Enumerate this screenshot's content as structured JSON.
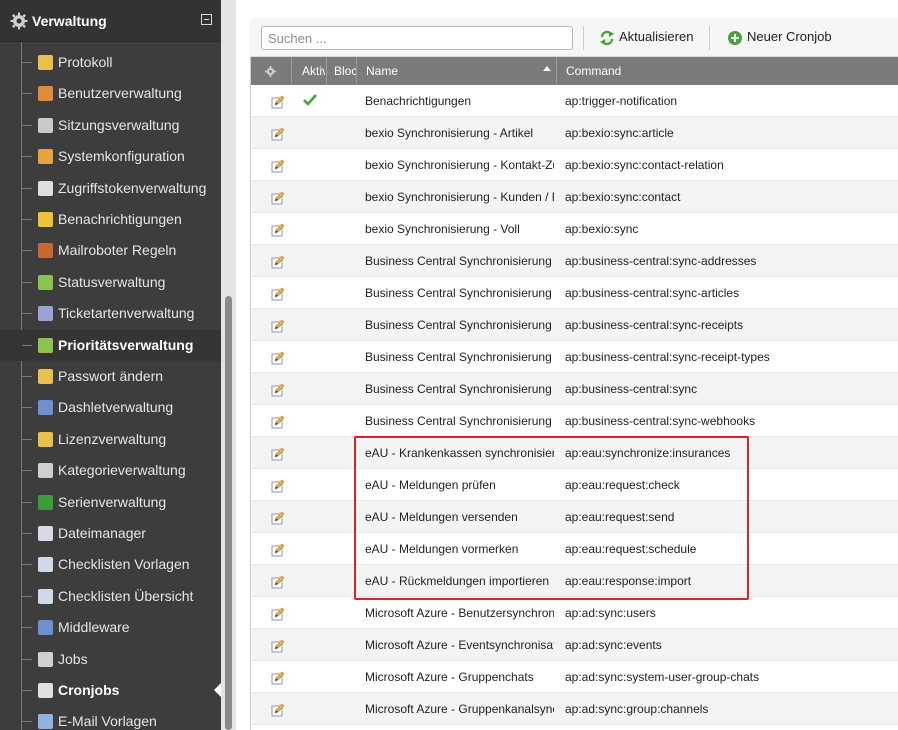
{
  "sidebar": {
    "title": "Verwaltung",
    "items": [
      {
        "label": "Protokoll",
        "icon": "pencil-icon",
        "color": "#e8c04a"
      },
      {
        "label": "Benutzerverwaltung",
        "icon": "user-icon",
        "color": "#e08a3c"
      },
      {
        "label": "Sitzungsverwaltung",
        "icon": "session-icon",
        "color": "#c9c9c9"
      },
      {
        "label": "Systemkonfiguration",
        "icon": "wrench-icon",
        "color": "#e8a33a"
      },
      {
        "label": "Zugriffstokenverwaltung",
        "icon": "infinity-icon",
        "color": "#dddddd"
      },
      {
        "label": "Benachrichtigungen",
        "icon": "note-icon",
        "color": "#f0c13b"
      },
      {
        "label": "Mailroboter Regeln",
        "icon": "hammer-icon",
        "color": "#c9682a"
      },
      {
        "label": "Statusverwaltung",
        "icon": "status-icon",
        "color": "#8cc34a"
      },
      {
        "label": "Ticketartenverwaltung",
        "icon": "tag-icon",
        "color": "#9aa3d6"
      },
      {
        "label": "Prioritätsverwaltung",
        "icon": "priority-icon",
        "color": "#8cc34a"
      },
      {
        "label": "Passwort ändern",
        "icon": "lock-icon",
        "color": "#e8c04a"
      },
      {
        "label": "Dashletverwaltung",
        "icon": "dashlet-icon",
        "color": "#6f8fd0"
      },
      {
        "label": "Lizenzverwaltung",
        "icon": "license-icon",
        "color": "#e8c04a"
      },
      {
        "label": "Kategorieverwaltung",
        "icon": "category-icon",
        "color": "#cfcfcf"
      },
      {
        "label": "Serienverwaltung",
        "icon": "series-icon",
        "color": "#3f9a3a"
      },
      {
        "label": "Dateimanager",
        "icon": "files-icon",
        "color": "#d8d8e8"
      },
      {
        "label": "Checklisten Vorlagen",
        "icon": "checklist-icon",
        "color": "#cfd8e8"
      },
      {
        "label": "Checklisten Übersicht",
        "icon": "checklist-overview-icon",
        "color": "#cfd8e8"
      },
      {
        "label": "Middleware",
        "icon": "middleware-icon",
        "color": "#6f8fd0"
      },
      {
        "label": "Jobs",
        "icon": "jobs-icon",
        "color": "#d0d0d0"
      },
      {
        "label": "Cronjobs",
        "icon": "cronjob-icon",
        "color": "#e0e0e0"
      },
      {
        "label": "E-Mail Vorlagen",
        "icon": "email-icon",
        "color": "#8fb3e0"
      }
    ]
  },
  "toolbar": {
    "search_placeholder": "Suchen ...",
    "refresh_label": "Aktualisieren",
    "new_label": "Neuer Cronjob"
  },
  "grid": {
    "headers": {
      "settings": "",
      "active": "Aktiv",
      "blocked": "Blockiert",
      "name": "Name",
      "command": "Command"
    },
    "rows": [
      {
        "name": "Benachrichtigungen",
        "command": "ap:trigger-notification",
        "active": true
      },
      {
        "name": "bexio Synchronisierung - Artikel",
        "command": "ap:bexio:sync:article",
        "active": false
      },
      {
        "name": "bexio Synchronisierung - Kontakt-Zuordnung",
        "command": "ap:bexio:sync:contact-relation",
        "active": false
      },
      {
        "name": "bexio Synchronisierung - Kunden / Kontakte",
        "command": "ap:bexio:sync:contact",
        "active": false
      },
      {
        "name": "bexio Synchronisierung - Voll",
        "command": "ap:bexio:sync",
        "active": false
      },
      {
        "name": "Business Central Synchronisierung",
        "command": "ap:business-central:sync-addresses",
        "active": false
      },
      {
        "name": "Business Central Synchronisierung",
        "command": "ap:business-central:sync-articles",
        "active": false
      },
      {
        "name": "Business Central Synchronisierung",
        "command": "ap:business-central:sync-receipts",
        "active": false
      },
      {
        "name": "Business Central Synchronisierung",
        "command": "ap:business-central:sync-receipt-types",
        "active": false
      },
      {
        "name": "Business Central Synchronisierung",
        "command": "ap:business-central:sync",
        "active": false
      },
      {
        "name": "Business Central Synchronisierung",
        "command": "ap:business-central:sync-webhooks",
        "active": false
      },
      {
        "name": "eAU - Krankenkassen synchronisieren",
        "command": "ap:eau:synchronize:insurances",
        "active": false
      },
      {
        "name": "eAU - Meldungen prüfen",
        "command": "ap:eau:request:check",
        "active": false
      },
      {
        "name": "eAU - Meldungen versenden",
        "command": "ap:eau:request:send",
        "active": false
      },
      {
        "name": "eAU - Meldungen vormerken",
        "command": "ap:eau:request:schedule",
        "active": false
      },
      {
        "name": "eAU - Rückmeldungen importieren",
        "command": "ap:eau:response:import",
        "active": false
      },
      {
        "name": "Microsoft Azure - Benutzersynchronisierung",
        "command": "ap:ad:sync:users",
        "active": false
      },
      {
        "name": "Microsoft Azure - Eventsynchronisation",
        "command": "ap:ad:sync:events",
        "active": false
      },
      {
        "name": "Microsoft Azure - Gruppenchats",
        "command": "ap:ad:sync:system-user-group-chats",
        "active": false
      },
      {
        "name": "Microsoft Azure - Gruppenkanalsynchronisierung",
        "command": "ap:ad:sync:group:channels",
        "active": false
      }
    ]
  },
  "colors": {
    "sidebar_bg": "#3d3d3d",
    "header_bg": "#7b7b7b",
    "highlight": "#d32626",
    "check": "#4aa33a"
  }
}
